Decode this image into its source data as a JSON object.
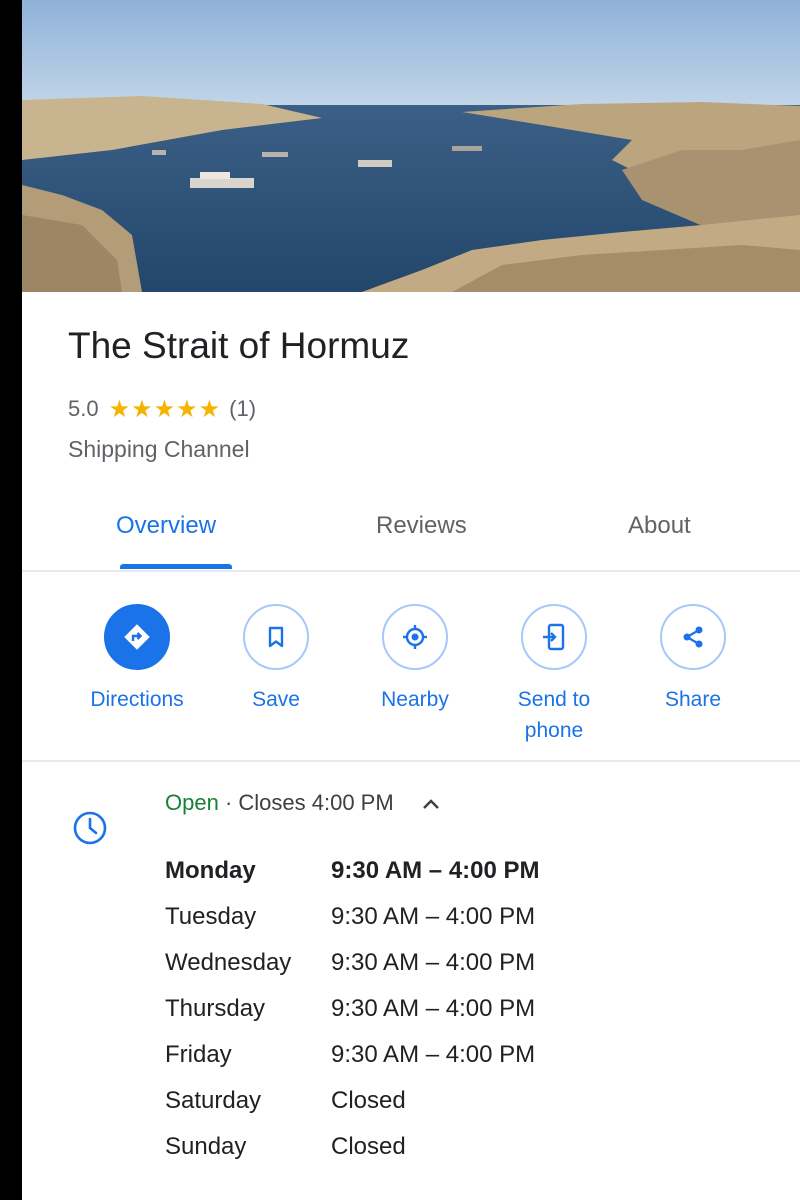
{
  "place": {
    "name": "The Strait of Hormuz",
    "rating": "5.0",
    "stars": "★★★★★",
    "review_count": "(1)",
    "category": "Shipping Channel"
  },
  "tabs": [
    {
      "label": "Overview",
      "active": true
    },
    {
      "label": "Reviews",
      "active": false
    },
    {
      "label": "About",
      "active": false
    }
  ],
  "actions": [
    {
      "label": "Directions",
      "icon": "directions-icon"
    },
    {
      "label": "Save",
      "icon": "bookmark-icon"
    },
    {
      "label": "Nearby",
      "icon": "nearby-icon"
    },
    {
      "label": "Send to phone",
      "icon": "send-to-phone-icon"
    },
    {
      "label": "Share",
      "icon": "share-icon"
    }
  ],
  "hours": {
    "open_label": "Open",
    "separator": " · ",
    "closes_text": "Closes 4:00 PM",
    "schedule": [
      {
        "day": "Monday",
        "time": "9:30 AM – 4:00 PM",
        "today": true
      },
      {
        "day": "Tuesday",
        "time": "9:30 AM – 4:00 PM"
      },
      {
        "day": "Wednesday",
        "time": "9:30 AM – 4:00 PM"
      },
      {
        "day": "Thursday",
        "time": "9:30 AM – 4:00 PM"
      },
      {
        "day": "Friday",
        "time": "9:30 AM – 4:00 PM"
      },
      {
        "day": "Saturday",
        "time": "Closed"
      },
      {
        "day": "Sunday",
        "time": "Closed"
      }
    ]
  },
  "colors": {
    "accent": "#1a73e8",
    "open_green": "#188038",
    "star_gold": "#f4b400"
  }
}
